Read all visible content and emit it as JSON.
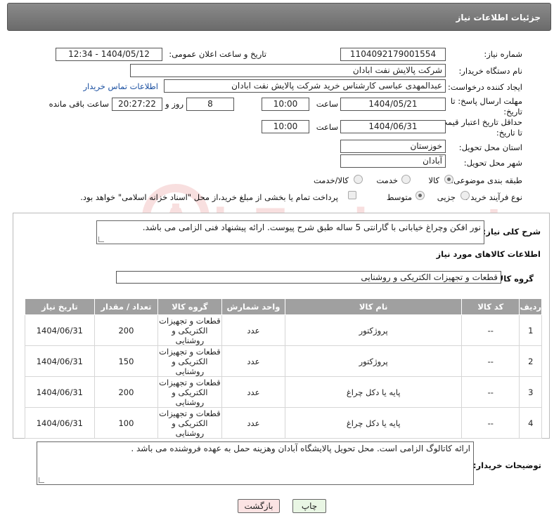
{
  "header": {
    "title": "جزئیات اطلاعات نیاز"
  },
  "fields": {
    "need_number_label": "شماره نیاز:",
    "need_number": "1104092179001554",
    "announce_label": "تاریخ و ساعت اعلان عمومی:",
    "announce_value": "1404/05/12 - 12:34",
    "buyer_org_label": "نام دستگاه خریدار:",
    "buyer_org": "شرکت پالایش نفت ابادان",
    "creator_label": "ایجاد کننده درخواست:",
    "creator": "عبدالمهدی  عباسی کارشناس خرید شرکت پالایش نفت ابادان",
    "contact_link": "اطلاعات تماس خریدار",
    "deadline_label_1": "مهلت ارسال پاسخ: تا",
    "deadline_label_2": "تاریخ:",
    "deadline_date": "1404/05/21",
    "time_label": "ساعت",
    "deadline_time": "10:00",
    "days_value": "8",
    "days_label": "روز و",
    "remaining_time": "20:27:22",
    "remaining_label": "ساعت باقی مانده",
    "validity_label_1": "حداقل تاریخ اعتبار قیمت:",
    "validity_label_2": "تا تاریخ:",
    "validity_date": "1404/06/31",
    "validity_time": "10:00",
    "province_label": "استان محل تحویل:",
    "province": "خوزستان",
    "city_label": "شهر محل تحویل:",
    "city": "آبادان",
    "category_label": "طبقه بندی موضوعی:",
    "category_options": [
      "کالا",
      "خدمت",
      "کالا/خدمت"
    ],
    "process_label": "نوع فرآیند خرید :",
    "process_options": [
      "جزیی",
      "متوسط"
    ],
    "payment_text": "پرداخت تمام یا بخشی از مبلغ خرید،از محل \"اسناد خزانه اسلامی\" خواهد بود."
  },
  "description": {
    "label": "شرح کلی نیاز:",
    "text": "نور افکن وچراغ خیابانی با گارانتی 5 ساله طبق شرح پیوست. ارائه پیشنهاد فنی الزامی می باشد."
  },
  "goods": {
    "title": "اطلاعات کالاهای مورد نیاز",
    "group_label": "گروه کالا:",
    "group_value": "قطعات و تجهیزات الکتریکی و روشنایی",
    "columns": [
      "ردیف",
      "کد کالا",
      "نام کالا",
      "واحد شمارش",
      "گروه کالا",
      "تعداد / مقدار",
      "تاریخ نیاز"
    ],
    "rows": [
      {
        "idx": "1",
        "code": "--",
        "name": "پروژکتور",
        "unit": "عدد",
        "group": "قطعات و تجهیزات الکتریکی و روشنایی",
        "qty": "200",
        "date": "1404/06/31"
      },
      {
        "idx": "2",
        "code": "--",
        "name": "پروژکتور",
        "unit": "عدد",
        "group": "قطعات و تجهیزات الکتریکی و روشنایی",
        "qty": "150",
        "date": "1404/06/31"
      },
      {
        "idx": "3",
        "code": "--",
        "name": "پایه یا دکل چراغ",
        "unit": "عدد",
        "group": "قطعات و تجهیزات الکتریکی و روشنایی",
        "qty": "200",
        "date": "1404/06/31"
      },
      {
        "idx": "4",
        "code": "--",
        "name": "پایه یا دکل چراغ",
        "unit": "عدد",
        "group": "قطعات و تجهیزات الکتریکی و روشنایی",
        "qty": "100",
        "date": "1404/06/31"
      }
    ]
  },
  "buyer_notes": {
    "label": "توضیحات خریدار:",
    "text": "ارائه کاتالوگ الزامی است. محل تحویل پالایشگاه آبادان وهزینه حمل به عهده فروشنده می باشد ."
  },
  "buttons": {
    "print": "چاپ",
    "back": "بازگشت"
  },
  "watermark": {
    "text": "AriaTender.net"
  },
  "colors": {
    "header": "#7a7a7a",
    "table_header": "#a0a0a0",
    "print_btn": "#e9f6e4",
    "back_btn": "#fbe3e3",
    "link": "#1a4fa0"
  }
}
